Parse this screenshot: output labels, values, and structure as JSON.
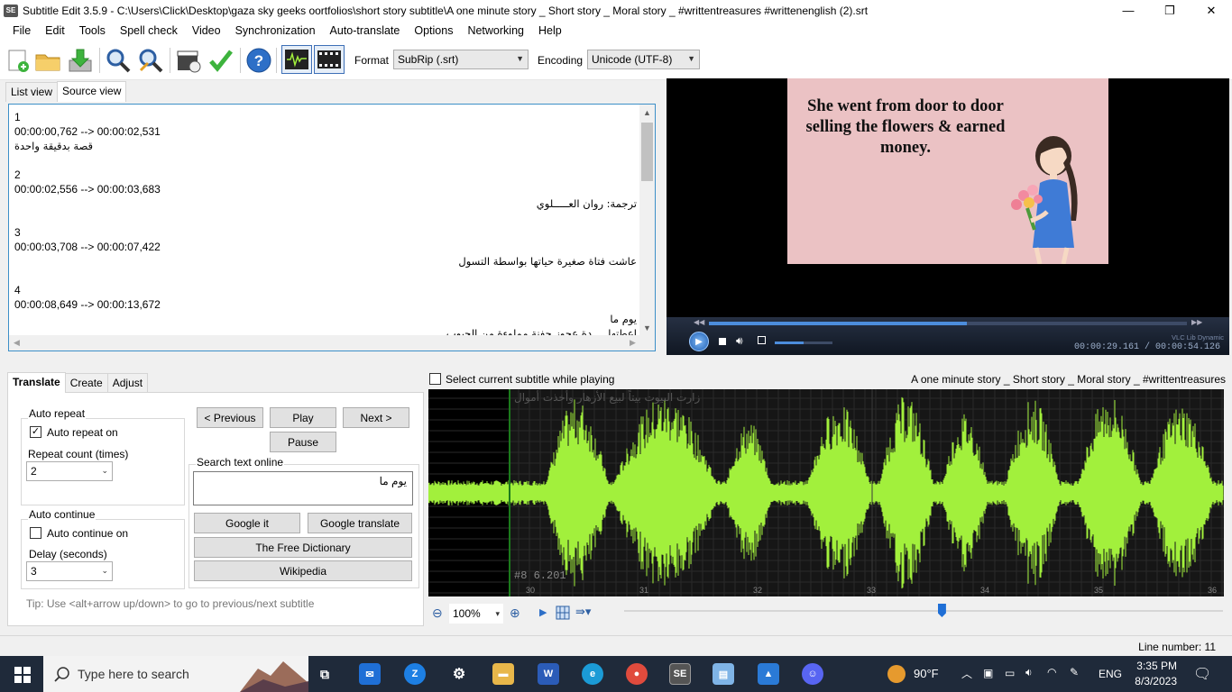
{
  "window": {
    "title": "Subtitle Edit 3.5.9 - C:\\Users\\Click\\Desktop\\gaza sky geeks oortfolios\\short story subtitle\\A one minute story _ Short story _ Moral story _ #writtentreasures #writtenenglish (2).srt",
    "icon_text": "SE",
    "minimize": "—",
    "maximize": "❐",
    "close": "✕"
  },
  "menu": [
    "File",
    "Edit",
    "Tools",
    "Spell check",
    "Video",
    "Synchronization",
    "Auto-translate",
    "Options",
    "Networking",
    "Help"
  ],
  "toolbar": {
    "format_label": "Format",
    "format_value": "SubRip (.srt)",
    "encoding_label": "Encoding",
    "encoding_value": "Unicode (UTF-8)"
  },
  "view_tabs": [
    "List view",
    "Source view"
  ],
  "source_lines": [
    "1",
    "00:00:00,762 --> 00:00:02,531",
    "قصة بدقيقة واحدة",
    "",
    "2",
    "00:00:02,556 --> 00:00:03,683",
    "ترجمة: روان العـــــلوي",
    "",
    "3",
    "00:00:03,708 --> 00:00:07,422",
    "عاشت فتاة صغيرة حياتها بواسطة التسول",
    "",
    "4",
    "00:00:08,649 --> 00:00:13,672",
    "يوم ما",
    "اعطتها ... دة عجوز حفنة مملوءة من الحبوب"
  ],
  "video": {
    "caption_lines": [
      "She went from door to door",
      "selling the flowers & earned",
      "money."
    ],
    "brand": "VLC Lib Dynamic",
    "time": "00:00:29.161 / 00:00:54.126",
    "position": 0.54,
    "volume": 0.5
  },
  "bottom_tabs": [
    "Translate",
    "Create",
    "Adjust"
  ],
  "translate": {
    "auto_repeat_title": "Auto repeat",
    "auto_repeat_on": "Auto repeat on",
    "repeat_count_label": "Repeat count (times)",
    "repeat_count_value": "2",
    "auto_continue_title": "Auto continue",
    "auto_continue_on": "Auto continue on",
    "delay_label": "Delay (seconds)",
    "delay_value": "3",
    "previous": "< Previous",
    "play": "Play",
    "next": "Next >",
    "pause": "Pause",
    "search_title": "Search text online",
    "search_text": "يوم ما",
    "google_it": "Google it",
    "google_translate": "Google translate",
    "free_dictionary": "The Free Dictionary",
    "wikipedia": "Wikipedia",
    "tip": "Tip: Use <alt+arrow up/down> to go to previous/next subtitle"
  },
  "waveform": {
    "select_label": "Select current subtitle while playing",
    "file_label": "A one minute story _ Short story _ Moral story _ #writtentreasures",
    "overlay_text": "زارت البيوت بيتاً لبيع الأزهار وأخذت أموال",
    "info": "#8  6.201",
    "ticks": [
      "30",
      "31",
      "32",
      "33",
      "34",
      "35",
      "36"
    ],
    "zoom": "100%",
    "slider_position": 0.53
  },
  "status": {
    "line_number": "Line number: 11"
  },
  "taskbar": {
    "search_placeholder": "Type here to search",
    "temperature": "90°F",
    "language": "ENG",
    "time": "3:35 PM",
    "date": "8/3/2023"
  },
  "colors": {
    "accent": "#3c8fc8",
    "waveform": "#a2f03c",
    "video_bg": "#ebc2c4"
  }
}
